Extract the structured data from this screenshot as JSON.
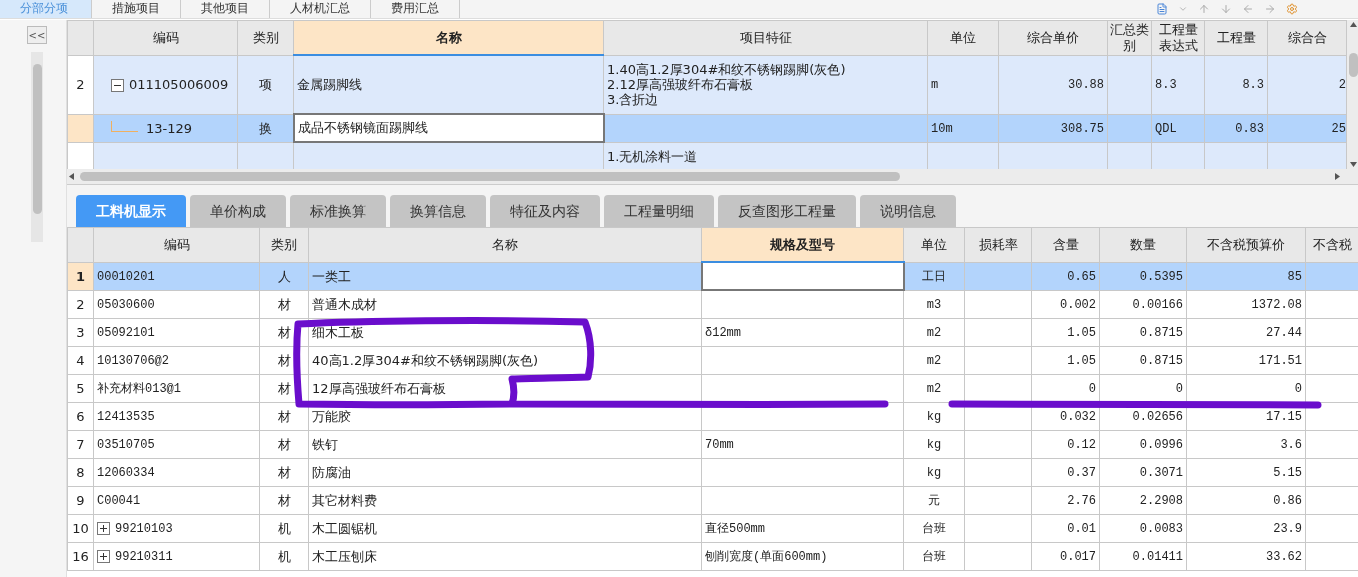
{
  "top_tabs": [
    {
      "label": "分部分项",
      "selected": true
    },
    {
      "label": "措施项目",
      "selected": false
    },
    {
      "label": "其他项目",
      "selected": false
    },
    {
      "label": "人材机汇总",
      "selected": false
    },
    {
      "label": "费用汇总",
      "selected": false
    }
  ],
  "collapse_button": "<<",
  "upper_grid": {
    "columns": [
      {
        "label": "编码",
        "selected": false
      },
      {
        "label": "类别",
        "selected": false
      },
      {
        "label": "名称",
        "selected": true
      },
      {
        "label": "项目特征",
        "selected": false
      },
      {
        "label": "单位",
        "selected": false
      },
      {
        "label": "综合单价",
        "selected": false
      },
      {
        "label": "汇总类别",
        "selected": false
      },
      {
        "label": "工程量表达式",
        "selected": false
      },
      {
        "label": "工程量",
        "selected": false
      },
      {
        "label": "综合合",
        "selected": false
      }
    ],
    "rows": [
      {
        "number": "2",
        "code": "011105006009",
        "expanded": true,
        "type": "项",
        "name": "金属踢脚线",
        "features": "1.40高1.2厚304#和纹不锈钢踢脚(灰色)\n2.12厚高强玻纤布石膏板\n3.含折边",
        "unit": "m",
        "unit_price": "30.88",
        "qty_expr": "8.3",
        "qty": "8.3",
        "total": "2",
        "selected": false,
        "children": [
          {
            "code": "13-129",
            "type": "换",
            "name": "成品不锈钢镜面踢脚线",
            "unit": "10m",
            "unit_price": "308.75",
            "qty_expr": "QDL",
            "qty": "0.83",
            "total": "25",
            "selected": true
          }
        ]
      },
      {
        "features": "1.无机涂料一道",
        "selected": false
      }
    ]
  },
  "detail_tabs": [
    {
      "label": "工料机显示",
      "selected": true
    },
    {
      "label": "单价构成",
      "selected": false
    },
    {
      "label": "标准换算",
      "selected": false
    },
    {
      "label": "换算信息",
      "selected": false
    },
    {
      "label": "特征及内容",
      "selected": false
    },
    {
      "label": "工程量明细",
      "selected": false
    },
    {
      "label": "反查图形工程量",
      "selected": false
    },
    {
      "label": "说明信息",
      "selected": false
    }
  ],
  "lower_grid": {
    "columns": [
      {
        "label": "编码",
        "selected": false
      },
      {
        "label": "类别",
        "selected": false
      },
      {
        "label": "名称",
        "selected": false
      },
      {
        "label": "规格及型号",
        "selected": true
      },
      {
        "label": "单位",
        "selected": false
      },
      {
        "label": "损耗率",
        "selected": false
      },
      {
        "label": "含量",
        "selected": false
      },
      {
        "label": "数量",
        "selected": false
      },
      {
        "label": "不含税预算价",
        "selected": false
      },
      {
        "label": "不含税",
        "selected": false
      }
    ],
    "rows": [
      {
        "number": "1",
        "code": "00010201",
        "type": "人",
        "name": "一类工",
        "unit": "工日",
        "content": "0.65",
        "quantity": "0.5395",
        "price": "85",
        "selected": true
      },
      {
        "number": "2",
        "code": "05030600",
        "type": "材",
        "name": "普通木成材",
        "unit": "m3",
        "content": "0.002",
        "quantity": "0.00166",
        "price": "1372.08",
        "selected": false
      },
      {
        "number": "3",
        "code": "05092101",
        "type": "材",
        "name": "细木工板",
        "spec": "δ12mm",
        "unit": "m2",
        "content": "1.05",
        "quantity": "0.8715",
        "price": "27.44",
        "selected": false
      },
      {
        "number": "4",
        "code": "10130706@2",
        "type": "材",
        "name": "40高1.2厚304#和纹不锈钢踢脚(灰色)",
        "unit": "m2",
        "content": "1.05",
        "quantity": "0.8715",
        "price": "171.51",
        "selected": false
      },
      {
        "number": "5",
        "code": "补充材料013@1",
        "type": "材",
        "name": "12厚高强玻纤布石膏板",
        "unit": "m2",
        "content": "0",
        "quantity": "0",
        "price": "0",
        "selected": false
      },
      {
        "number": "6",
        "code": "12413535",
        "type": "材",
        "name": "万能胶",
        "unit": "kg",
        "content": "0.032",
        "quantity": "0.02656",
        "price": "17.15",
        "selected": false
      },
      {
        "number": "7",
        "code": "03510705",
        "type": "材",
        "name": "铁钉",
        "spec": "70mm",
        "unit": "kg",
        "content": "0.12",
        "quantity": "0.0996",
        "price": "3.6",
        "selected": false
      },
      {
        "number": "8",
        "code": "12060334",
        "type": "材",
        "name": "防腐油",
        "unit": "kg",
        "content": "0.37",
        "quantity": "0.3071",
        "price": "5.15",
        "selected": false
      },
      {
        "number": "9",
        "code": "C00041",
        "type": "材",
        "name": "其它材料费",
        "unit": "元",
        "content": "2.76",
        "quantity": "2.2908",
        "price": "0.86",
        "selected": false
      },
      {
        "number": "10",
        "code": "99210103",
        "expanded": false,
        "type": "机",
        "name": "木工圆锯机",
        "spec": "直径500mm",
        "unit": "台班",
        "content": "0.01",
        "quantity": "0.0083",
        "price": "23.9",
        "selected": false
      },
      {
        "number": "16",
        "code": "99210311",
        "expanded": false,
        "type": "机",
        "name": "木工压刨床",
        "spec": "刨削宽度(单面600mm)",
        "unit": "台班",
        "content": "0.017",
        "quantity": "0.01411",
        "price": "33.62",
        "selected": false
      }
    ]
  }
}
